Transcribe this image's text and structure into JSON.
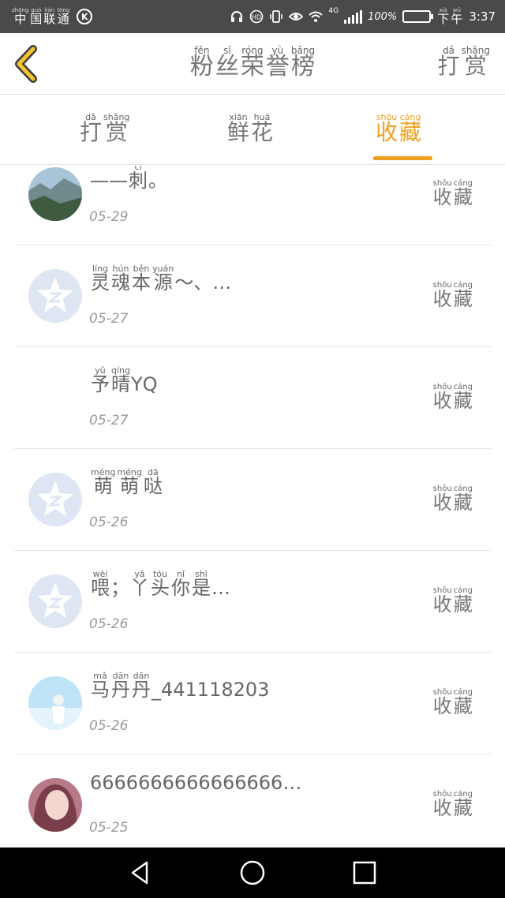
{
  "status_bar": {
    "carrier": [
      {
        "py": "zhōng",
        "hz": "中"
      },
      {
        "py": "guó",
        "hz": "国"
      },
      {
        "py": "lián",
        "hz": "联"
      },
      {
        "py": "tōng",
        "hz": "通"
      }
    ],
    "carrier_badge": "K",
    "network": "4G",
    "battery_text": "100%",
    "battery_level": 1.0,
    "period": [
      {
        "py": "xià",
        "hz": "下"
      },
      {
        "py": "wǔ",
        "hz": "午"
      }
    ],
    "time": "3:37",
    "icons": [
      "headset-icon",
      "hd-call-icon",
      "vibrate-icon",
      "eye-icon",
      "wifi-icon",
      "signal-icon",
      "battery-charging-icon"
    ]
  },
  "header": {
    "back_icon": "chevron-left-icon",
    "title": [
      {
        "py": "fěn",
        "hz": "粉"
      },
      {
        "py": "sī",
        "hz": "丝"
      },
      {
        "py": "róng",
        "hz": "荣"
      },
      {
        "py": "yù",
        "hz": "誉"
      },
      {
        "py": "bǎng",
        "hz": "榜"
      }
    ],
    "reward_button": [
      {
        "py": "dǎ",
        "hz": "打"
      },
      {
        "py": "shǎng",
        "hz": "赏"
      }
    ]
  },
  "tabs": [
    {
      "id": "reward",
      "chars": [
        {
          "py": "dǎ",
          "hz": "打"
        },
        {
          "py": "shǎng",
          "hz": "赏"
        }
      ],
      "active": false
    },
    {
      "id": "flowers",
      "chars": [
        {
          "py": "xiān",
          "hz": "鲜"
        },
        {
          "py": "huā",
          "hz": "花"
        }
      ],
      "active": false
    },
    {
      "id": "collect",
      "chars": [
        {
          "py": "shōu",
          "hz": "收"
        },
        {
          "py": "cáng",
          "hz": "藏"
        }
      ],
      "active": true
    }
  ],
  "accent_color": "#f0a020",
  "collect_label": [
    {
      "py": "shōu",
      "hz": "收"
    },
    {
      "py": "cáng",
      "hz": "藏"
    }
  ],
  "fans": [
    {
      "avatar": "landscape",
      "name": [
        {
          "t": "——"
        },
        {
          "py": "cì",
          "hz": "刺"
        },
        {
          "t": "。"
        }
      ],
      "date": "05-29"
    },
    {
      "avatar": "default",
      "name": [
        {
          "py": "líng",
          "hz": "灵"
        },
        {
          "py": "hún",
          "hz": "魂"
        },
        {
          "py": "běn",
          "hz": "本"
        },
        {
          "py": "yuán",
          "hz": "源"
        },
        {
          "t": "～、…"
        }
      ],
      "date": "05-27"
    },
    {
      "avatar": "none",
      "name": [
        {
          "py": "yǔ",
          "hz": "予"
        },
        {
          "py": "qíng",
          "hz": "晴"
        },
        {
          "t": "YQ"
        }
      ],
      "date": "05-27"
    },
    {
      "avatar": "default",
      "name": [
        {
          "py": "méng",
          "hz": "萌"
        },
        {
          "py": "méng",
          "hz": "萌"
        },
        {
          "py": "dā",
          "hz": "哒"
        }
      ],
      "date": "05-26"
    },
    {
      "avatar": "default",
      "name": [
        {
          "py": "wèi",
          "hz": "喂"
        },
        {
          "t": "；"
        },
        {
          "py": "yā",
          "hz": "丫"
        },
        {
          "py": "tóu",
          "hz": "头"
        },
        {
          "py": "nǐ",
          "hz": "你"
        },
        {
          "py": "shì",
          "hz": "是"
        },
        {
          "t": "…"
        }
      ],
      "date": "05-26"
    },
    {
      "avatar": "sky",
      "name": [
        {
          "py": "mǎ",
          "hz": "马"
        },
        {
          "py": "dān",
          "hz": "丹"
        },
        {
          "py": "dān",
          "hz": "丹"
        },
        {
          "t": "_441118203"
        }
      ],
      "date": "05-26"
    },
    {
      "avatar": "portrait",
      "name": [
        {
          "t": "6666666666666666…"
        }
      ],
      "date": "05-25"
    }
  ],
  "nav_icons": [
    "back-triangle-icon",
    "home-circle-icon",
    "recents-square-icon"
  ]
}
